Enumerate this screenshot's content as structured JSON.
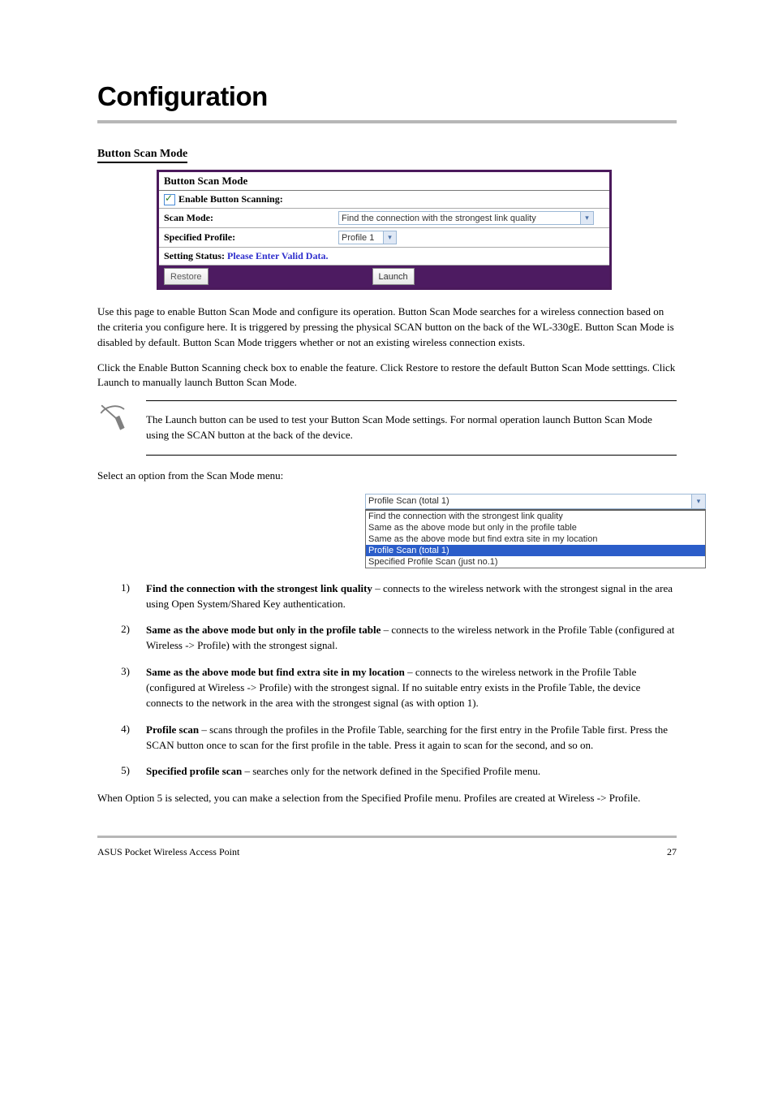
{
  "chapter_title": "Configuration",
  "section_title": "Button Scan Mode",
  "panel": {
    "header": "Button Scan Mode",
    "enable_label": "Enable Button Scanning:",
    "scan_mode_label": "Scan Mode:",
    "scan_mode_value": "Find the connection with the strongest link quality",
    "specified_profile_label": "Specified Profile:",
    "specified_profile_value": "Profile 1",
    "status_prefix": "Setting Status: ",
    "status_value": "Please Enter Valid Data.",
    "restore_btn": "Restore",
    "launch_btn": "Launch"
  },
  "para1": "Use this page to enable Button Scan Mode and configure its operation. Button Scan Mode searches for a wireless connection based on the criteria you configure here. It is triggered by pressing the physical SCAN button on the back of the WL-330gE. Button Scan Mode is disabled by default. Button Scan Mode triggers whether or not an existing wireless connection exists.",
  "para2": "Click the Enable Button Scanning check box to enable the feature. Click Restore to restore the default Button Scan Mode setttings. Click Launch to manually launch Button Scan Mode.",
  "note": "The Launch button can be used to test your Button Scan Mode settings. For normal operation launch Button Scan Mode using the SCAN button at the back of the device.",
  "para3": "Select an option from the Scan Mode menu:",
  "dropdown": {
    "current": "Profile Scan (total 1)",
    "items": [
      "Find the connection with the strongest link quality",
      "Same as the above mode but only in the profile table",
      "Same as the above mode but find extra site in my location",
      "Profile Scan (total 1)",
      "Specified Profile Scan (just no.1)"
    ],
    "selected_index": 3
  },
  "options": [
    {
      "num": "1)",
      "name": "Find the connection with the strongest link quality",
      "desc": " – connects to the wireless network with the strongest signal in the area using Open System/Shared Key authentication."
    },
    {
      "num": "2)",
      "name": "Same as the above mode but only in the profile table",
      "desc": " – connects to the wireless network in the Profile Table (configured at Wireless -> Profile) with the strongest signal."
    },
    {
      "num": "3)",
      "name": "Same as the above mode but find extra site in my location",
      "desc": " – connects to the wireless network in the Profile Table (configured at Wireless -> Profile) with the strongest signal. If no suitable entry exists in the Profile Table, the device connects to the network in the area with the strongest signal (as with option 1)."
    },
    {
      "num": "4)",
      "name": "Profile scan",
      "desc": " – scans through the profiles in the Profile Table, searching for the first entry in the Profile Table first. Press the SCAN button once to scan for the first profile in the table. Press it again to scan for the second, and so on."
    },
    {
      "num": "5)",
      "name": "Specified profile scan",
      "desc": " – searches only for the network defined in the Specified Profile menu."
    }
  ],
  "para4": "When Option 5 is selected, you can make a selection from the Specified Profile menu. Profiles are created at Wireless -> Profile.",
  "footer_left": "ASUS Pocket Wireless Access Point",
  "footer_right": "27"
}
